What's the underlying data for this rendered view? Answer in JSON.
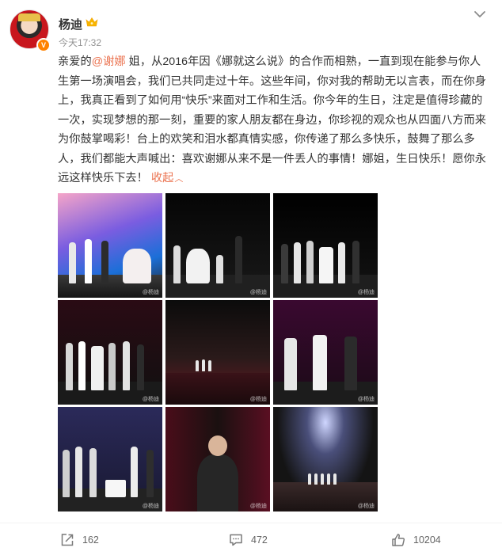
{
  "post": {
    "author": "杨迪",
    "time": "今天17:32",
    "verified_badge": "V",
    "text_before_mention": "亲爱的",
    "mention": "@谢娜",
    "text_after_mention": " 姐，从2016年因《娜就这么说》的合作而相熟，一直到现在能参与你人生第一场演唱会，我们已共同走过十年。这些年间，你对我的帮助无以言表，而在你身上，我真正看到了如何用“快乐”来面对工作和生活。你今年的生日，注定是值得珍藏的一次，实现梦想的那一刻，重要的家人朋友都在身边，你珍视的观众也从四面八方而来为你鼓掌喝彩！台上的欢笑和泪水都真情实感，你传递了那么多快乐，鼓舞了那么多人，我们都能大声喊出：喜欢谢娜从来不是一件丢人的事情！娜姐，生日快乐！愿你永远这样快乐下去！",
    "collapse_label": "收起",
    "photo_watermark": "@杨迪",
    "icons": {
      "avatar_badge": "verified-icon",
      "name_badge": "crown-icon",
      "menu": "chevron-down-icon",
      "repost": "share-icon",
      "comment": "comment-icon",
      "like": "thumbs-up-icon"
    },
    "colors": {
      "accent": "#eb7350",
      "badge": "#ff8200",
      "text": "#333333",
      "muted": "#939393"
    }
  },
  "actions": {
    "repost_count": "162",
    "comment_count": "472",
    "like_count": "10204"
  }
}
